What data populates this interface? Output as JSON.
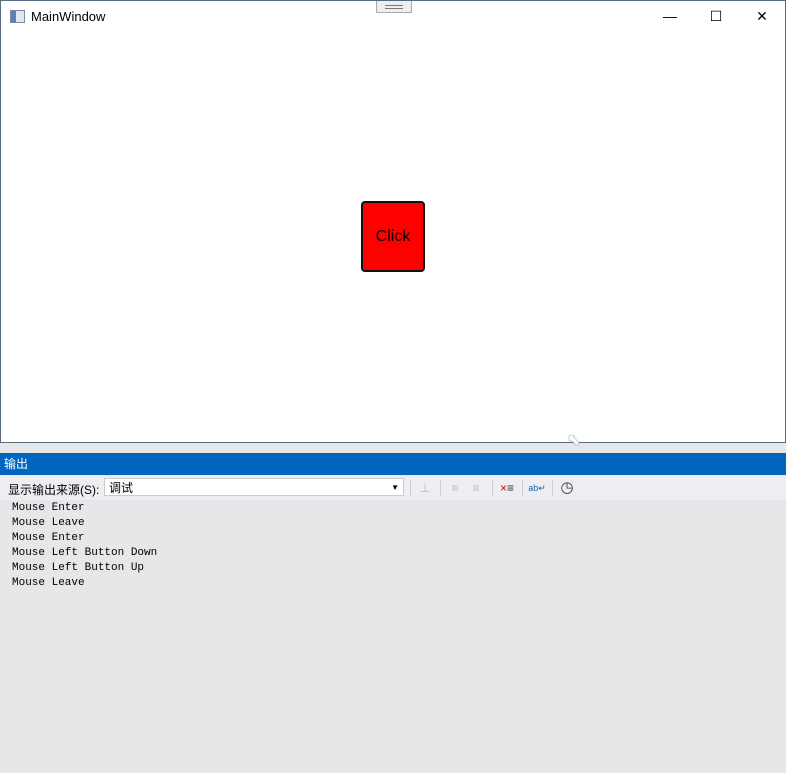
{
  "window": {
    "title": "MainWindow",
    "button_label": "Click",
    "button_color": "#ff0000"
  },
  "output_panel": {
    "title": "输出",
    "source_label": "显示输出来源(S):",
    "source_value": "调试",
    "lines": [
      "Mouse Enter",
      "Mouse Leave",
      "Mouse Enter",
      "Mouse Left Button Down",
      "Mouse Left Button Up",
      "Mouse Leave"
    ]
  }
}
